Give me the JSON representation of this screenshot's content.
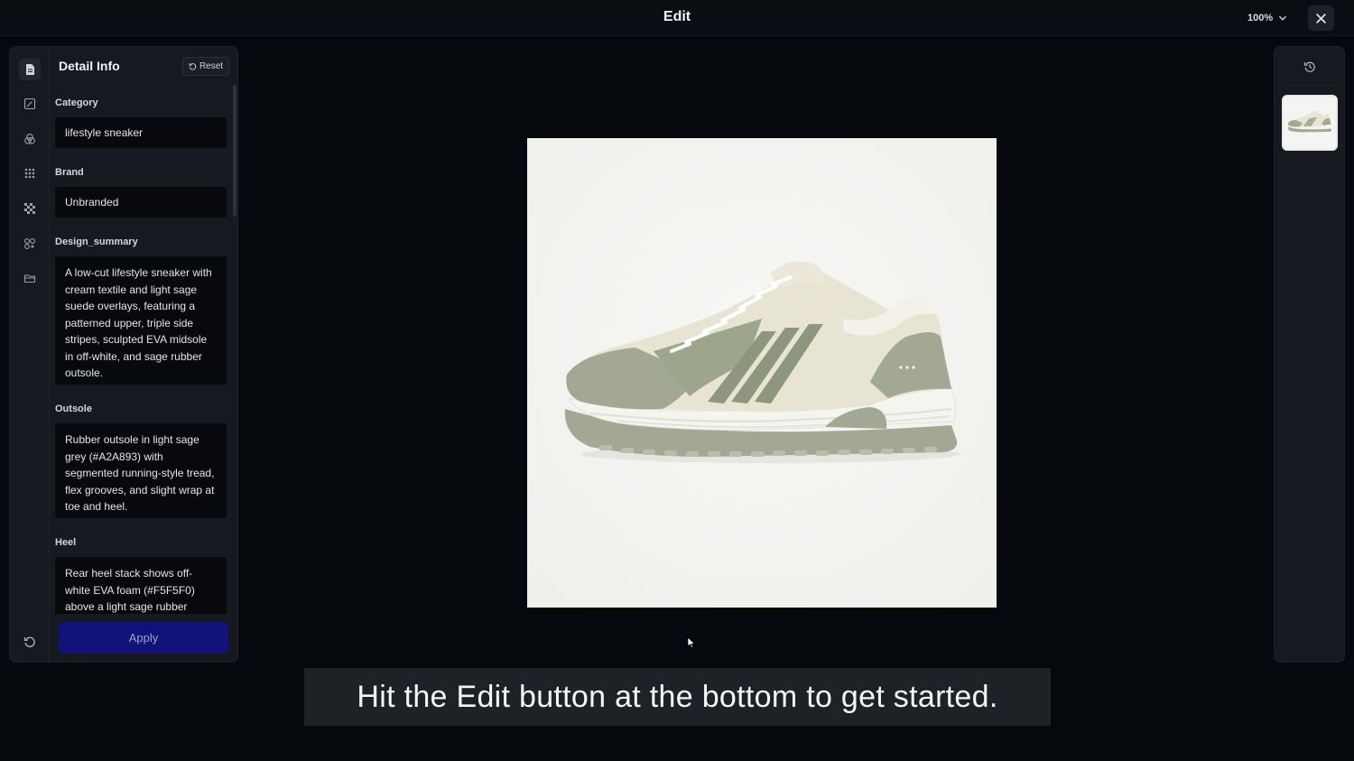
{
  "window": {
    "title": "Edit",
    "zoom_label": "100%"
  },
  "icons": {
    "close": "close-icon",
    "zoom_dropdown": "chevron-down-icon",
    "rail": [
      "document-icon",
      "edit-icon",
      "color-palette-icon",
      "grid-icon",
      "pattern-icon",
      "components-icon",
      "layers-icon"
    ],
    "undo": "undo-icon",
    "history": "history-icon",
    "reset": "reset-icon"
  },
  "left_panel": {
    "title": "Detail Info",
    "reset_label": "Reset",
    "fields": {
      "category": {
        "label": "Category",
        "value": "lifestyle sneaker"
      },
      "brand": {
        "label": "Brand",
        "value": "Unbranded"
      },
      "design_summary": {
        "label": "Design_summary",
        "value": "A low-cut lifestyle sneaker with cream textile and light sage suede overlays, featuring a patterned upper, triple side stripes, sculpted EVA midsole in off-white, and sage rubber outsole."
      },
      "outsole": {
        "label": "Outsole",
        "value": "Rubber outsole in light sage grey (#A2A893) with segmented running-style tread, flex grooves, and slight wrap at toe and heel."
      },
      "heel": {
        "label": "Heel",
        "value": "Rear heel stack shows off-white EVA foam (#F5F5F0) above a light sage rubber"
      }
    },
    "apply_label": "Apply"
  },
  "caption": {
    "text": "Hit the Edit button at the bottom to get started."
  },
  "colors": {
    "background": "#05080d",
    "panel": "#161a20",
    "field": "#07090d",
    "apply": "#11127a",
    "sage": "#a2a893",
    "cream": "#e8e4d3",
    "off_white": "#f5f5f0"
  }
}
